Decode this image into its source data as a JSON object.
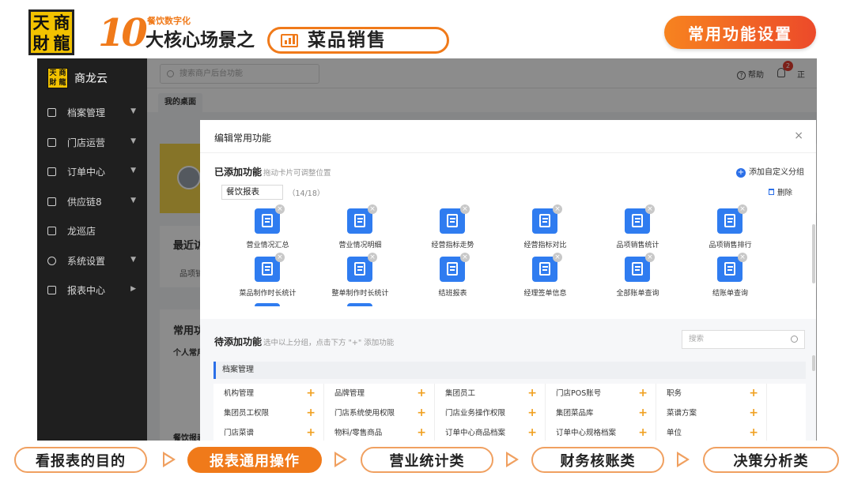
{
  "banner": {
    "logo_chars": [
      "天",
      "商",
      "財",
      "龍"
    ],
    "number": "10",
    "subtitle": "餐饮数字化",
    "title": "大核心场景之",
    "scene": "菜品销售",
    "setting_button": "常用功能设置",
    "accent": "#f07a1a"
  },
  "app": {
    "brand": "商龙云",
    "logo_chars": [
      "天",
      "商",
      "財",
      "龍"
    ],
    "sidebar": [
      {
        "label": "档案管理",
        "icon": "archive-icon"
      },
      {
        "label": "门店运营",
        "icon": "store-icon"
      },
      {
        "label": "订单中心",
        "icon": "order-icon"
      },
      {
        "label": "供应链8",
        "icon": "supply-icon"
      },
      {
        "label": "龙巡店",
        "icon": "org-icon"
      },
      {
        "label": "系统设置",
        "icon": "settings-icon"
      },
      {
        "label": "报表中心",
        "icon": "chart-icon"
      }
    ],
    "search_placeholder": "搜索商户后台功能",
    "help": "帮助",
    "badge_count": "2",
    "right_text": "正",
    "tab_home": "我的桌面",
    "bg_recent": "最近访",
    "bg_recent_item": "品项销",
    "bg_common": "常用功",
    "bg_personal": "个人常用",
    "bg_report": "餐饮报表"
  },
  "modal": {
    "title": "编辑常用功能",
    "close": "×",
    "added_title": "已添加功能",
    "added_hint": "拖动卡片可调整位置",
    "add_custom": "添加自定义分组",
    "group_name": "餐饮报表",
    "group_count": "（14/18）",
    "delete": "删除",
    "functions": [
      "营业情况汇总",
      "营业情况明细",
      "经营指标走势",
      "经营指标对比",
      "品项销售统计",
      "品项销售排行",
      "菜品制作时长统计",
      "整单制作时长统计",
      "结班报表",
      "经理签单信息",
      "全部账单查询",
      "结账单查询"
    ],
    "pending_title": "待添加功能",
    "pending_hint": "选中以上分组，点击下方 \"+\" 添加功能",
    "search_placeholder": "搜索",
    "category": "档案管理",
    "cells": [
      [
        "机构管理",
        "品牌管理",
        "集团员工",
        "门店POS账号",
        "职务"
      ],
      [
        "集团员工权限",
        "门店系统使用权限",
        "门店业务操作权限",
        "集团菜品库",
        "菜谱方案"
      ],
      [
        "门店菜谱",
        "物料/零售商品",
        "订单中心商品档案",
        "订单中心规格档案",
        "单位"
      ]
    ]
  },
  "bottom_nav": [
    {
      "label": "看报表的目的",
      "active": false
    },
    {
      "label": "报表通用操作",
      "active": true
    },
    {
      "label": "营业统计类",
      "active": false
    },
    {
      "label": "财务核账类",
      "active": false
    },
    {
      "label": "决策分析类",
      "active": false
    }
  ]
}
